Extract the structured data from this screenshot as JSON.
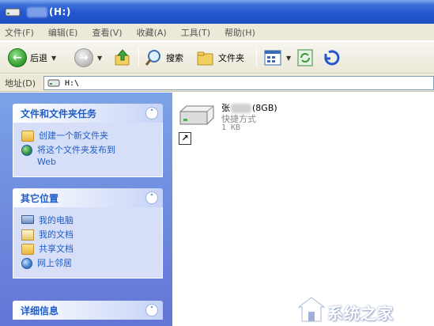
{
  "window": {
    "title": "(H:)"
  },
  "menu": [
    "文件(F)",
    "编辑(E)",
    "查看(V)",
    "收藏(A)",
    "工具(T)",
    "帮助(H)"
  ],
  "toolbar": {
    "back_label": "后退",
    "search_label": "搜索",
    "folders_label": "文件夹"
  },
  "address": {
    "label": "地址(D)",
    "value": "H:\\"
  },
  "tasks_panel": {
    "title": "文件和文件夹任务",
    "items": [
      {
        "label": "创建一个新文件夹",
        "icon": "new-folder-icon"
      },
      {
        "label": "将这个文件夹发布到",
        "label2": "Web",
        "icon": "publish-web-icon"
      }
    ]
  },
  "places_panel": {
    "title": "其它位置",
    "items": [
      {
        "label": "我的电脑",
        "icon": "my-computer-icon"
      },
      {
        "label": "我的文档",
        "icon": "my-documents-icon"
      },
      {
        "label": "共享文档",
        "icon": "shared-documents-icon"
      },
      {
        "label": "网上邻居",
        "icon": "network-places-icon"
      }
    ]
  },
  "details_panel": {
    "title": "详细信息"
  },
  "file": {
    "name_prefix": "张",
    "name_suffix": "(8GB)",
    "type": "快捷方式",
    "size": "1 KB"
  },
  "watermark": {
    "text": "系统之家"
  },
  "colors": {
    "title_bar": "#2457cf",
    "task_pane": "#7ba2e7",
    "link": "#215dc6",
    "chrome": "#ece9d8"
  }
}
